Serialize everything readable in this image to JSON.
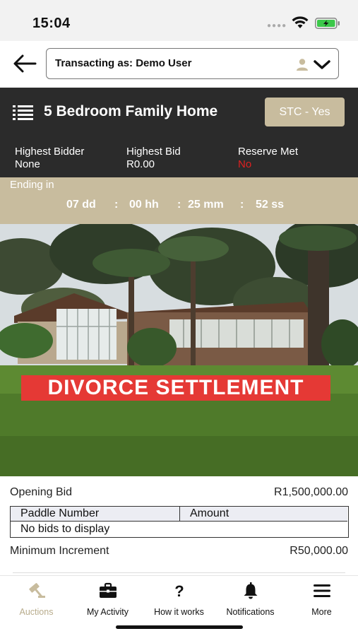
{
  "status_bar": {
    "time": "15:04"
  },
  "header": {
    "transacting_label": "Transacting as: Demo User"
  },
  "auction": {
    "title": "5 Bedroom Family Home",
    "stc_label": "STC - Yes"
  },
  "bid_info": {
    "highest_bidder_label": "Highest Bidder",
    "highest_bidder_value": "None",
    "highest_bid_label": "Highest Bid",
    "highest_bid_value": "R0.00",
    "reserve_met_label": "Reserve Met",
    "reserve_met_value": "No"
  },
  "ending": {
    "label": "Ending in",
    "days": "07 dd",
    "sep1": ":",
    "hours": "00 hh",
    "sep2": ":",
    "minutes": "25 mm",
    "sep3": ":",
    "seconds": "52 ss"
  },
  "photo": {
    "banner_text": "DIVORCE SETTLEMENT"
  },
  "details": {
    "opening_bid_label": "Opening Bid",
    "opening_bid_value": "R1,500,000.00",
    "table_headers": [
      "Paddle Number",
      "Amount"
    ],
    "empty_text": "No bids to display",
    "min_increment_label": "Minimum Increment",
    "min_increment_value": "R50,000.00"
  },
  "tabs": [
    {
      "label": "Auctions",
      "icon": "gavel-icon",
      "active": true
    },
    {
      "label": "My Activity",
      "icon": "briefcase-icon",
      "active": false
    },
    {
      "label": "How it works",
      "icon": "question-icon",
      "active": false
    },
    {
      "label": "Notifications",
      "icon": "bell-icon",
      "active": false
    },
    {
      "label": "More",
      "icon": "menu-icon",
      "active": false
    }
  ],
  "colors": {
    "dark_bar": "#2b2b2b",
    "accent_tan": "#c8bc9e",
    "alert_red": "#e53935",
    "battery_green": "#3cc84a"
  }
}
